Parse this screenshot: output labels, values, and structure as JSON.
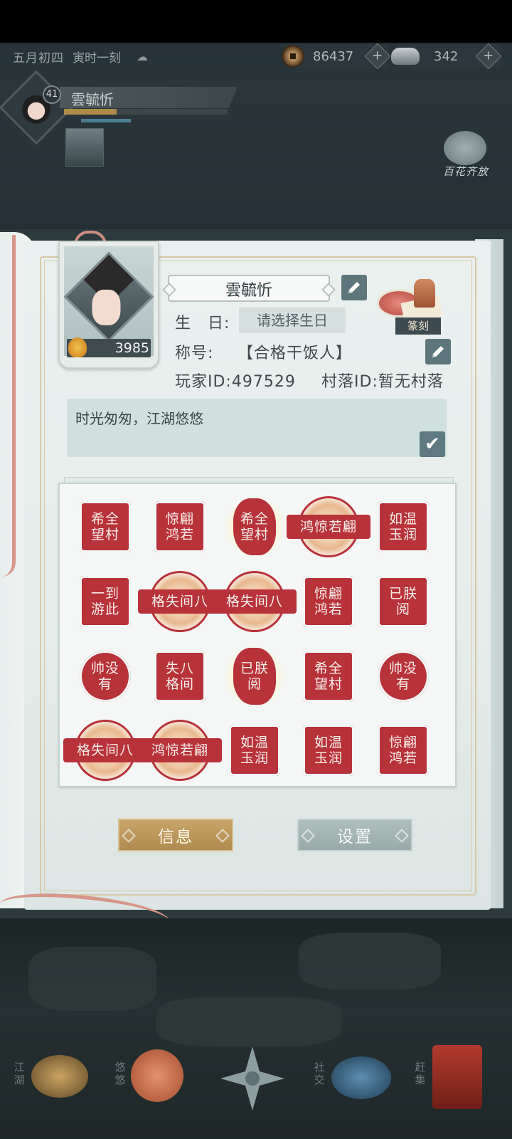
{
  "status": {
    "date": "五月初四",
    "time": "寅时一刻",
    "weather_icon": "rain-cloud-icon",
    "coins": "86437",
    "ingots": "342"
  },
  "player": {
    "level": "41",
    "name": "雲毓忻",
    "exp_fraction": 0.32
  },
  "event": {
    "label": "百花齐放"
  },
  "profile": {
    "power": "3985",
    "name": "雲毓忻",
    "birthday_label": "生　日:",
    "birthday_value": "请选择生日",
    "title_label": "称号:",
    "title_value": "【合格干饭人】",
    "player_id": "玩家ID:497529",
    "village_id": "村落ID:暂无村落",
    "seal_label": "篆刻",
    "signature": "时光匆匆，江湖悠悠"
  },
  "stamps": [
    {
      "text": "希全\n望村",
      "shape": "square"
    },
    {
      "text": "惊翩\n鸿若",
      "shape": "square"
    },
    {
      "text": "希全\n望村",
      "shape": "oval"
    },
    {
      "text": "鸿惊若翩",
      "shape": "band"
    },
    {
      "text": "如温\n玉润",
      "shape": "square"
    },
    {
      "text": "一到\n游此",
      "shape": "square"
    },
    {
      "text": "格失间八",
      "shape": "band"
    },
    {
      "text": "格失间八",
      "shape": "band"
    },
    {
      "text": "惊翩\n鸿若",
      "shape": "square"
    },
    {
      "text": "已朕\n阅",
      "shape": "square"
    },
    {
      "text": "帅没\n有",
      "shape": "round"
    },
    {
      "text": "失八\n格间",
      "shape": "square"
    },
    {
      "text": "已朕\n阅",
      "shape": "oval"
    },
    {
      "text": "希全\n望村",
      "shape": "square"
    },
    {
      "text": "帅没\n有",
      "shape": "round"
    },
    {
      "text": "格失间八",
      "shape": "band"
    },
    {
      "text": "鸿惊若翩",
      "shape": "band"
    },
    {
      "text": "如温\n玉润",
      "shape": "square"
    },
    {
      "text": "如温\n玉润",
      "shape": "square"
    },
    {
      "text": "惊翩\n鸿若",
      "shape": "square"
    }
  ],
  "buttons": {
    "info": "信息",
    "settings": "设置"
  },
  "nav": [
    {
      "label": "江湖"
    },
    {
      "label": "悠悠"
    },
    {
      "label": ""
    },
    {
      "label": "社交"
    },
    {
      "label": "赶集"
    }
  ],
  "colors": {
    "seal_red": "#b8323a",
    "gold_button": "#c7a468",
    "teal_button": "#98aaa9"
  }
}
